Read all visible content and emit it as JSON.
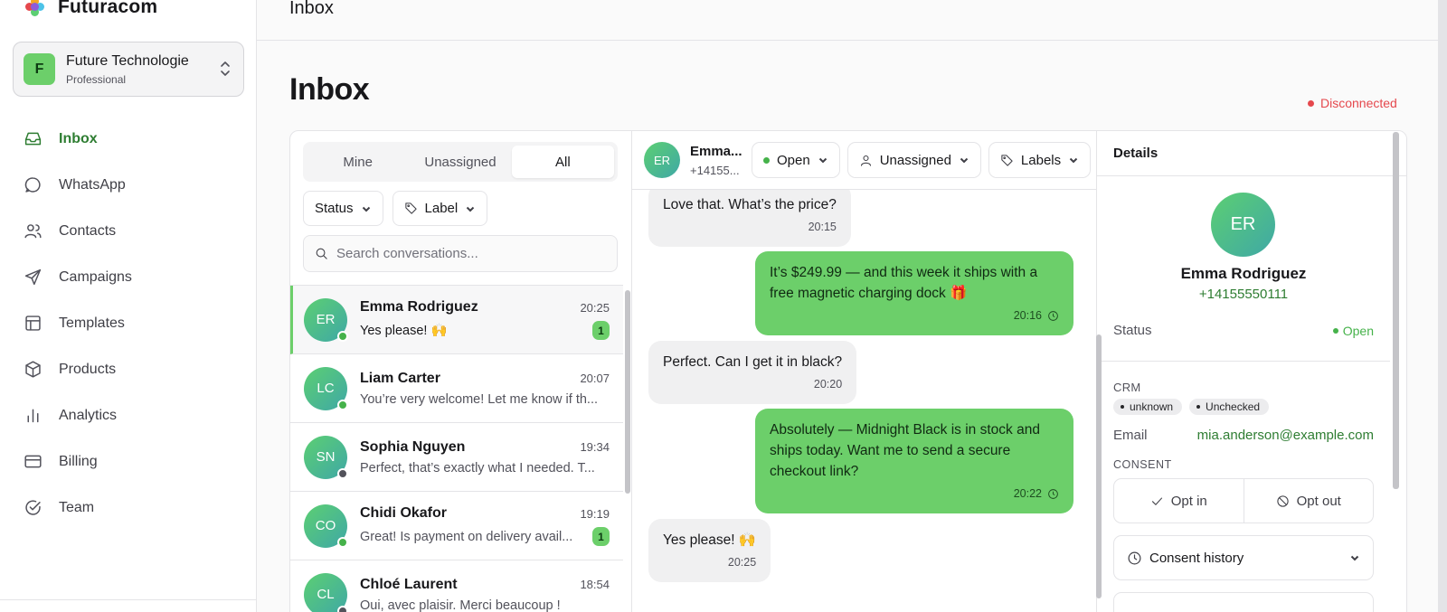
{
  "brand": {
    "name": "Futuracom"
  },
  "workspace": {
    "initial": "F",
    "name": "Future Technologie",
    "plan": "Professional"
  },
  "nav": [
    {
      "label": "Inbox",
      "icon": "inbox-icon",
      "active": true
    },
    {
      "label": "WhatsApp",
      "icon": "chat-bubble-icon"
    },
    {
      "label": "Contacts",
      "icon": "users-icon"
    },
    {
      "label": "Campaigns",
      "icon": "send-icon"
    },
    {
      "label": "Templates",
      "icon": "layout-icon"
    },
    {
      "label": "Products",
      "icon": "package-icon"
    },
    {
      "label": "Analytics",
      "icon": "bar-chart-icon"
    },
    {
      "label": "Billing",
      "icon": "credit-card-icon"
    },
    {
      "label": "Team",
      "icon": "check-circle-icon"
    }
  ],
  "topbar": {
    "title": "Inbox"
  },
  "page": {
    "title": "Inbox",
    "connection_status": "Disconnected"
  },
  "colors": {
    "accent": "#6ccf6a",
    "accent_text": "#2e7d32",
    "error": "#e5484d",
    "online": "#45b24a",
    "offline": "#52525b"
  },
  "conversations": {
    "tabs": [
      "Mine",
      "Unassigned",
      "All"
    ],
    "active_tab": "All",
    "filters": {
      "status": "Status",
      "label": "Label"
    },
    "search_placeholder": "Search conversations...",
    "items": [
      {
        "initials": "ER",
        "name": "Emma Rodriguez",
        "time": "20:25",
        "preview": "Yes please! 🙌",
        "unread": "1",
        "online": true
      },
      {
        "initials": "LC",
        "name": "Liam Carter",
        "time": "20:07",
        "preview": "You’re very welcome! Let me know if th...",
        "unread": "",
        "online": true
      },
      {
        "initials": "SN",
        "name": "Sophia Nguyen",
        "time": "19:34",
        "preview": "Perfect, that’s exactly what I needed. T...",
        "unread": "",
        "online": false
      },
      {
        "initials": "CO",
        "name": "Chidi Okafor",
        "time": "19:19",
        "preview": "Great! Is payment on delivery avail...",
        "unread": "1",
        "online": true
      },
      {
        "initials": "CL",
        "name": "Chloé Laurent",
        "time": "18:54",
        "preview": "Oui, avec plaisir. Merci beaucoup !",
        "unread": "",
        "online": false
      }
    ]
  },
  "chat": {
    "contact_initials": "ER",
    "contact_name": "Emma...",
    "contact_phone": "+14155...",
    "status_label": "Open",
    "assignee_label": "Unassigned",
    "labels_label": "Labels",
    "messages": [
      {
        "dir": "in",
        "text": "Love that. What’s the price?",
        "time": "20:15"
      },
      {
        "dir": "out",
        "text": "It’s $249.99 — and this week it ships with a free magnetic charging dock 🎁",
        "time": "20:16"
      },
      {
        "dir": "in",
        "text": "Perfect. Can I get it in black?",
        "time": "20:20"
      },
      {
        "dir": "out",
        "text": "Absolutely — Midnight Black is in stock and ships today. Want me to send a secure checkout link?",
        "time": "20:22"
      },
      {
        "dir": "in",
        "text": "Yes please! 🙌",
        "time": "20:25"
      }
    ]
  },
  "details": {
    "header": "Details",
    "initials": "ER",
    "name": "Emma Rodriguez",
    "phone": "+14155550111",
    "status_label": "Status",
    "status_value": "Open",
    "crm_label": "CRM",
    "tags": [
      "unknown",
      "Unchecked"
    ],
    "email_label": "Email",
    "email_value": "mia.anderson@example.com",
    "consent_label": "CONSENT",
    "opt_in": "Opt in",
    "opt_out": "Opt out",
    "consent_history": "Consent history"
  }
}
